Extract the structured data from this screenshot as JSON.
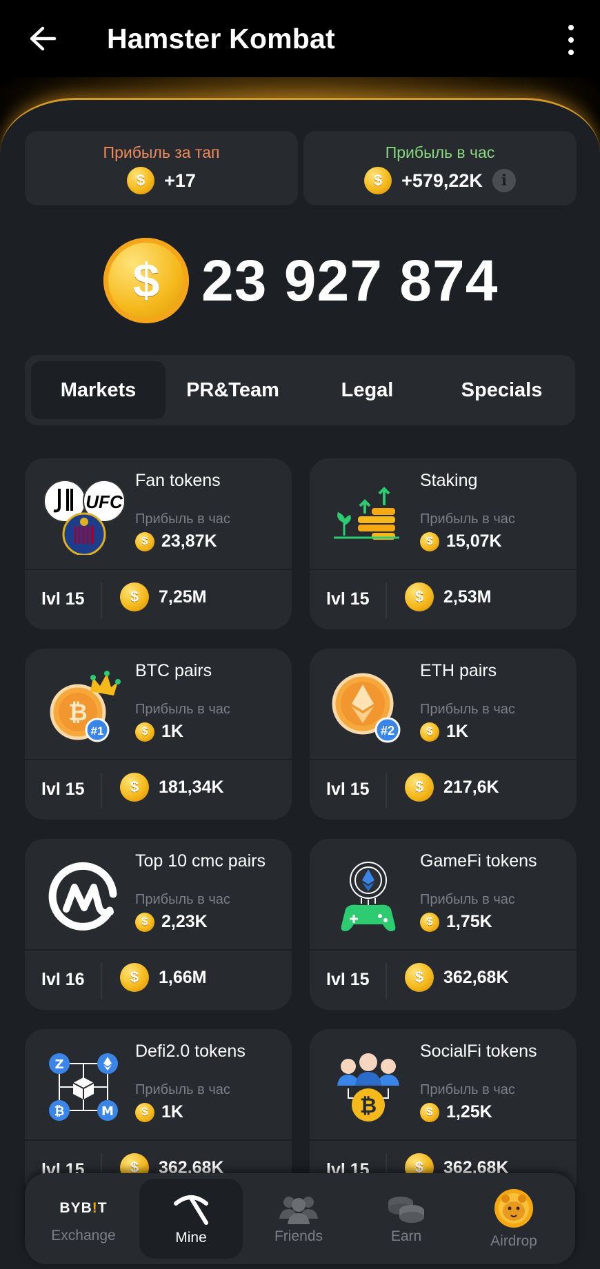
{
  "header": {
    "title": "Hamster Kombat"
  },
  "stats": {
    "tap": {
      "label": "Прибыль за тап",
      "value": "+17",
      "color": "#f08a5d"
    },
    "hour": {
      "label": "Прибыль в час",
      "value": "+579,22K",
      "color": "#89d77f"
    }
  },
  "balance": "23 927 874",
  "tabs": [
    "Markets",
    "PR&Team",
    "Legal",
    "Specials"
  ],
  "cards": [
    {
      "name": "Fan tokens",
      "profit_label": "Прибыль в час",
      "profit": "23,87K",
      "level": "lvl 15",
      "cost": "7,25M"
    },
    {
      "name": "Staking",
      "profit_label": "Прибыль в час",
      "profit": "15,07K",
      "level": "lvl 15",
      "cost": "2,53M"
    },
    {
      "name": "BTC pairs",
      "profit_label": "Прибыль в час",
      "profit": "1K",
      "level": "lvl 15",
      "cost": "181,34K"
    },
    {
      "name": "ETH pairs",
      "profit_label": "Прибыль в час",
      "profit": "1K",
      "level": "lvl 15",
      "cost": "217,6K"
    },
    {
      "name": "Top 10 cmc pairs",
      "profit_label": "Прибыль в час",
      "profit": "2,23K",
      "level": "lvl 16",
      "cost": "1,66M"
    },
    {
      "name": "GameFi tokens",
      "profit_label": "Прибыль в час",
      "profit": "1,75K",
      "level": "lvl 15",
      "cost": "362,68K"
    },
    {
      "name": "Defi2.0 tokens",
      "profit_label": "Прибыль в час",
      "profit": "1K",
      "level": "lvl 15",
      "cost": "362,68K"
    },
    {
      "name": "SocialFi tokens",
      "profit_label": "Прибыль в час",
      "profit": "1,25K",
      "level": "lvl 15",
      "cost": "362,68K"
    }
  ],
  "icon_labels": {
    "ufc": "UFC",
    "btc_rank": "#1",
    "eth_rank": "#2"
  },
  "nav": {
    "bybit_logo": "BYB!T",
    "items": [
      {
        "label": "Exchange",
        "icon": "bybit-logo"
      },
      {
        "label": "Mine",
        "icon": "pickaxe-icon",
        "active": true
      },
      {
        "label": "Friends",
        "icon": "friends-icon"
      },
      {
        "label": "Earn",
        "icon": "coins-icon"
      },
      {
        "label": "Airdrop",
        "icon": "hamster-coin-icon"
      }
    ]
  },
  "colors": {
    "panel": "#1c1f24",
    "card": "#272a2f",
    "gold": "#f5b91c",
    "muted": "#7c7f85"
  }
}
